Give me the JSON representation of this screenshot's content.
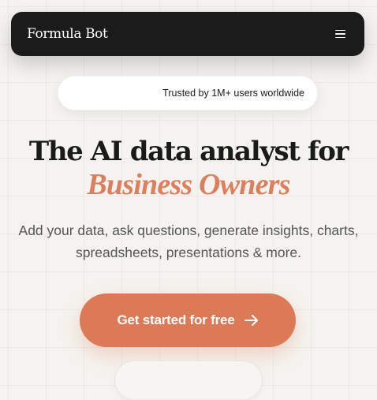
{
  "navbar": {
    "brand": "Formula Bot",
    "menu_icon": "hamburger-menu-icon"
  },
  "trust_badge": {
    "text": "Trusted by 1M+ users worldwide"
  },
  "hero": {
    "headline": "The AI data analyst for",
    "headline_accent": "Business Owners",
    "subtext": "Add your data, ask questions, generate insights, charts, spreadsheets, presentations & more."
  },
  "cta": {
    "label": "Get started for free",
    "icon": "arrow-right-icon"
  },
  "colors": {
    "accent": "#dc7a57",
    "navbar_bg": "#1b1b1b",
    "page_bg": "#f5f3ef"
  }
}
